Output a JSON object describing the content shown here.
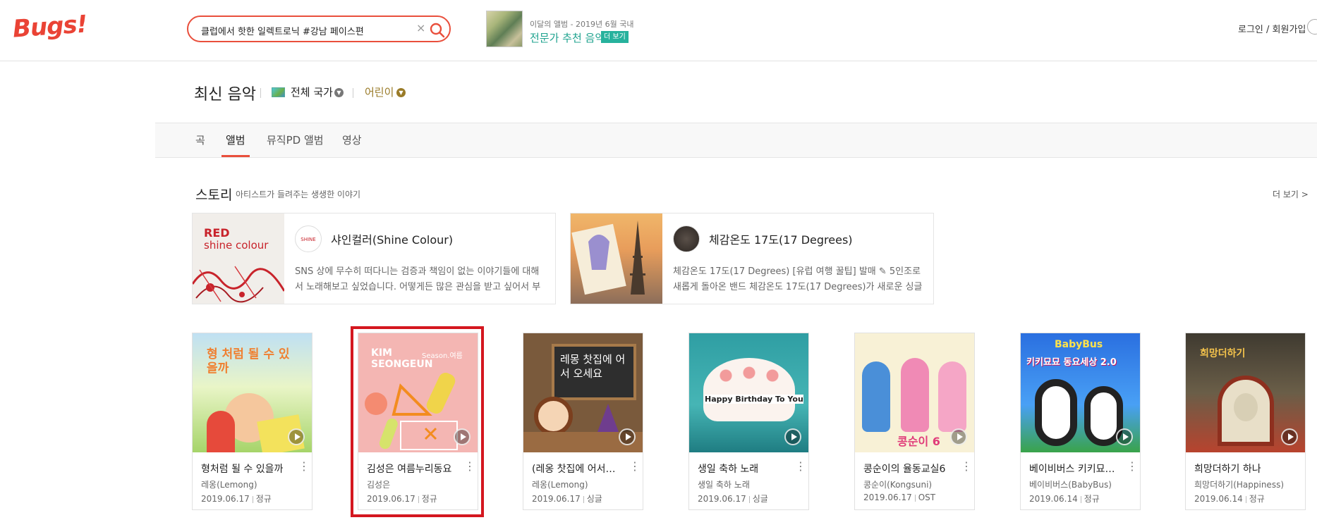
{
  "header": {
    "logo": "Bugs!",
    "search_value": "클럽에서 핫한 일렉트로닉 #강남 페이스편",
    "promo_sub": "이달의 앨범 - 2019년 6월 국내",
    "promo_title": "전문가 추천 음악",
    "promo_more": "더 보기",
    "login": "로그인 / 회원가입"
  },
  "page": {
    "title": "최신 음악",
    "country": "전체 국가",
    "genre": "어린이"
  },
  "tabs": [
    "곡",
    "앨범",
    "뮤직PD 앨범",
    "영상"
  ],
  "active_tab": "앨범",
  "story": {
    "title": "스토리",
    "subtitle": "아티스트가 들려주는 생생한 이야기",
    "more": "더 보기 >",
    "cards": [
      {
        "cover_line1": "RED",
        "cover_line2": "shine colour",
        "icon_text": "SHINE COLOUR",
        "name": "샤인컬러(Shine Colour)",
        "desc": "SNS 상에 무수히 떠다니는 검증과 책임이 없는 이야기들에 대해서 노래해보고 싶었습니다. 어떻게든 많은 관심을 받고 싶어서 부모님도 못"
      },
      {
        "name": "체감온도 17도(17 Degrees)",
        "desc": "체감온도 17도(17 Degrees) [유럽 여행 꿀팁] 발매 ✎ 5인조로 새롭게 돌아온 밴드 체감온도 17도(17 Degrees)가 새로운 싱글"
      }
    ]
  },
  "albums": [
    {
      "title": "형처럼 될 수 있을까",
      "artist": "레옹(Lemong)",
      "date": "2019.06.17",
      "type": "정규",
      "cover_text": "형 처럼 될 수 있을까"
    },
    {
      "title": "김성은 여름누리동요",
      "artist": "김성은",
      "date": "2019.06.17",
      "type": "정규",
      "cover_text_1": "KIM",
      "cover_text_2": "SEONGEUN",
      "cover_text_3": "Season.여름"
    },
    {
      "title": "(레옹 찻집에 어서오세요)",
      "artist": "레옹(Lemong)",
      "date": "2019.06.17",
      "type": "싱글",
      "cover_text": "레몽 찻집에 어서 오세요"
    },
    {
      "title": "생일 축하 노래",
      "artist": "생일 축하 노래",
      "date": "2019.06.17",
      "type": "싱글",
      "cover_text": "Happy Birthday To You"
    },
    {
      "title": "콩순이의 율동교실6",
      "artist": "콩순이(Kongsuni)",
      "date": "2019.06.17",
      "type": "OST",
      "cover_text": "콩순이 6"
    },
    {
      "title": "베이비버스 키키묘묘 동요세상",
      "artist": "베이비버스(BabyBus)",
      "date": "2019.06.14",
      "type": "정규",
      "cover_text_1": "BabyBus",
      "cover_text_2": "키키묘묘 동요세상 2.0"
    },
    {
      "title": "희망더하기 하나",
      "artist": "희망더하기(Happiness)",
      "date": "2019.06.14",
      "type": "정규",
      "cover_text": "희망더하기"
    }
  ],
  "colors": {
    "brand": "#ea4335",
    "accent_teal": "#27b29d",
    "highlight_red": "#d4171f"
  }
}
